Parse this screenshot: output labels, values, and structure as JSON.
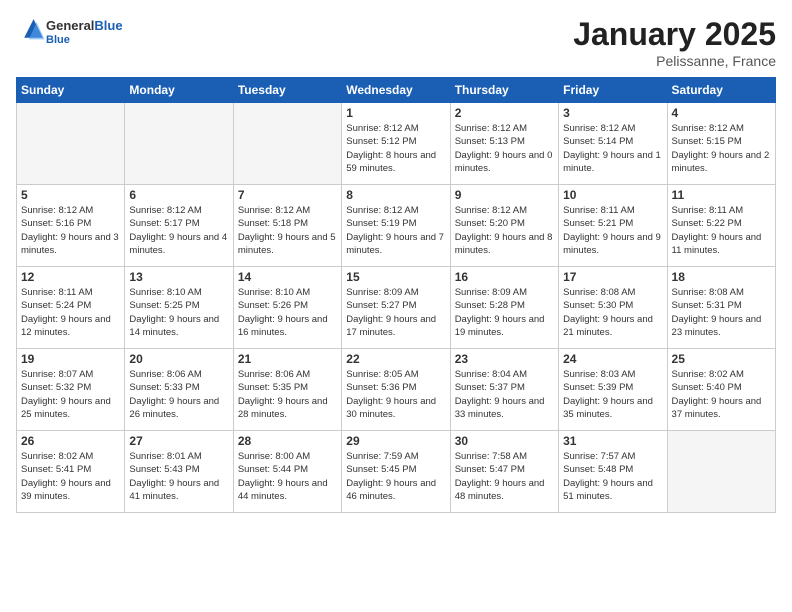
{
  "header": {
    "logo_general": "General",
    "logo_blue": "Blue",
    "month_title": "January 2025",
    "location": "Pelissanne, France"
  },
  "weekdays": [
    "Sunday",
    "Monday",
    "Tuesday",
    "Wednesday",
    "Thursday",
    "Friday",
    "Saturday"
  ],
  "weeks": [
    [
      {
        "day": "",
        "empty": true
      },
      {
        "day": "",
        "empty": true
      },
      {
        "day": "",
        "empty": true
      },
      {
        "day": "1",
        "sunrise": "Sunrise: 8:12 AM",
        "sunset": "Sunset: 5:12 PM",
        "daylight": "Daylight: 8 hours and 59 minutes."
      },
      {
        "day": "2",
        "sunrise": "Sunrise: 8:12 AM",
        "sunset": "Sunset: 5:13 PM",
        "daylight": "Daylight: 9 hours and 0 minutes."
      },
      {
        "day": "3",
        "sunrise": "Sunrise: 8:12 AM",
        "sunset": "Sunset: 5:14 PM",
        "daylight": "Daylight: 9 hours and 1 minute."
      },
      {
        "day": "4",
        "sunrise": "Sunrise: 8:12 AM",
        "sunset": "Sunset: 5:15 PM",
        "daylight": "Daylight: 9 hours and 2 minutes."
      }
    ],
    [
      {
        "day": "5",
        "sunrise": "Sunrise: 8:12 AM",
        "sunset": "Sunset: 5:16 PM",
        "daylight": "Daylight: 9 hours and 3 minutes."
      },
      {
        "day": "6",
        "sunrise": "Sunrise: 8:12 AM",
        "sunset": "Sunset: 5:17 PM",
        "daylight": "Daylight: 9 hours and 4 minutes."
      },
      {
        "day": "7",
        "sunrise": "Sunrise: 8:12 AM",
        "sunset": "Sunset: 5:18 PM",
        "daylight": "Daylight: 9 hours and 5 minutes."
      },
      {
        "day": "8",
        "sunrise": "Sunrise: 8:12 AM",
        "sunset": "Sunset: 5:19 PM",
        "daylight": "Daylight: 9 hours and 7 minutes."
      },
      {
        "day": "9",
        "sunrise": "Sunrise: 8:12 AM",
        "sunset": "Sunset: 5:20 PM",
        "daylight": "Daylight: 9 hours and 8 minutes."
      },
      {
        "day": "10",
        "sunrise": "Sunrise: 8:11 AM",
        "sunset": "Sunset: 5:21 PM",
        "daylight": "Daylight: 9 hours and 9 minutes."
      },
      {
        "day": "11",
        "sunrise": "Sunrise: 8:11 AM",
        "sunset": "Sunset: 5:22 PM",
        "daylight": "Daylight: 9 hours and 11 minutes."
      }
    ],
    [
      {
        "day": "12",
        "sunrise": "Sunrise: 8:11 AM",
        "sunset": "Sunset: 5:24 PM",
        "daylight": "Daylight: 9 hours and 12 minutes."
      },
      {
        "day": "13",
        "sunrise": "Sunrise: 8:10 AM",
        "sunset": "Sunset: 5:25 PM",
        "daylight": "Daylight: 9 hours and 14 minutes."
      },
      {
        "day": "14",
        "sunrise": "Sunrise: 8:10 AM",
        "sunset": "Sunset: 5:26 PM",
        "daylight": "Daylight: 9 hours and 16 minutes."
      },
      {
        "day": "15",
        "sunrise": "Sunrise: 8:09 AM",
        "sunset": "Sunset: 5:27 PM",
        "daylight": "Daylight: 9 hours and 17 minutes."
      },
      {
        "day": "16",
        "sunrise": "Sunrise: 8:09 AM",
        "sunset": "Sunset: 5:28 PM",
        "daylight": "Daylight: 9 hours and 19 minutes."
      },
      {
        "day": "17",
        "sunrise": "Sunrise: 8:08 AM",
        "sunset": "Sunset: 5:30 PM",
        "daylight": "Daylight: 9 hours and 21 minutes."
      },
      {
        "day": "18",
        "sunrise": "Sunrise: 8:08 AM",
        "sunset": "Sunset: 5:31 PM",
        "daylight": "Daylight: 9 hours and 23 minutes."
      }
    ],
    [
      {
        "day": "19",
        "sunrise": "Sunrise: 8:07 AM",
        "sunset": "Sunset: 5:32 PM",
        "daylight": "Daylight: 9 hours and 25 minutes."
      },
      {
        "day": "20",
        "sunrise": "Sunrise: 8:06 AM",
        "sunset": "Sunset: 5:33 PM",
        "daylight": "Daylight: 9 hours and 26 minutes."
      },
      {
        "day": "21",
        "sunrise": "Sunrise: 8:06 AM",
        "sunset": "Sunset: 5:35 PM",
        "daylight": "Daylight: 9 hours and 28 minutes."
      },
      {
        "day": "22",
        "sunrise": "Sunrise: 8:05 AM",
        "sunset": "Sunset: 5:36 PM",
        "daylight": "Daylight: 9 hours and 30 minutes."
      },
      {
        "day": "23",
        "sunrise": "Sunrise: 8:04 AM",
        "sunset": "Sunset: 5:37 PM",
        "daylight": "Daylight: 9 hours and 33 minutes."
      },
      {
        "day": "24",
        "sunrise": "Sunrise: 8:03 AM",
        "sunset": "Sunset: 5:39 PM",
        "daylight": "Daylight: 9 hours and 35 minutes."
      },
      {
        "day": "25",
        "sunrise": "Sunrise: 8:02 AM",
        "sunset": "Sunset: 5:40 PM",
        "daylight": "Daylight: 9 hours and 37 minutes."
      }
    ],
    [
      {
        "day": "26",
        "sunrise": "Sunrise: 8:02 AM",
        "sunset": "Sunset: 5:41 PM",
        "daylight": "Daylight: 9 hours and 39 minutes."
      },
      {
        "day": "27",
        "sunrise": "Sunrise: 8:01 AM",
        "sunset": "Sunset: 5:43 PM",
        "daylight": "Daylight: 9 hours and 41 minutes."
      },
      {
        "day": "28",
        "sunrise": "Sunrise: 8:00 AM",
        "sunset": "Sunset: 5:44 PM",
        "daylight": "Daylight: 9 hours and 44 minutes."
      },
      {
        "day": "29",
        "sunrise": "Sunrise: 7:59 AM",
        "sunset": "Sunset: 5:45 PM",
        "daylight": "Daylight: 9 hours and 46 minutes."
      },
      {
        "day": "30",
        "sunrise": "Sunrise: 7:58 AM",
        "sunset": "Sunset: 5:47 PM",
        "daylight": "Daylight: 9 hours and 48 minutes."
      },
      {
        "day": "31",
        "sunrise": "Sunrise: 7:57 AM",
        "sunset": "Sunset: 5:48 PM",
        "daylight": "Daylight: 9 hours and 51 minutes."
      },
      {
        "day": "",
        "empty": true
      }
    ]
  ]
}
